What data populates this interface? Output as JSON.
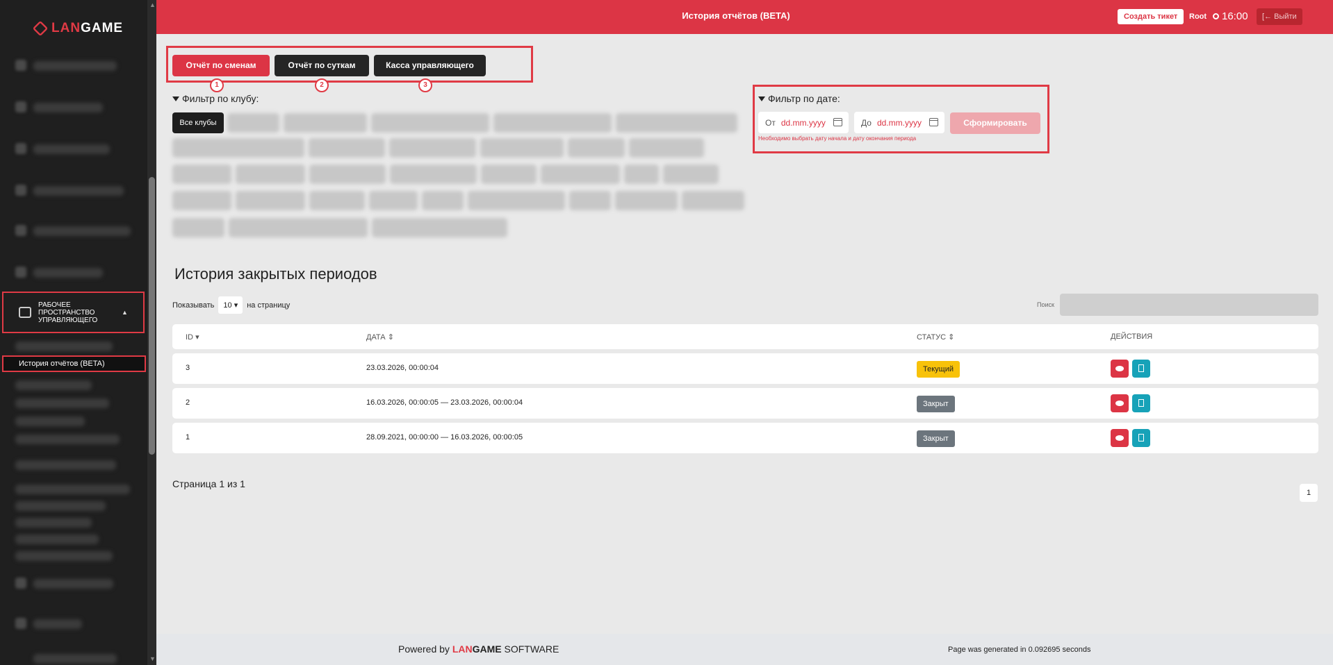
{
  "brand": {
    "logo_prefix": "LAN",
    "logo_suffix": "GAME"
  },
  "header": {
    "title": "История отчётов (BETA)",
    "create_ticket": "Создать тикет",
    "user": "Root",
    "time": "16:00",
    "logout": "Выйти"
  },
  "sidebar": {
    "section_label": "Рабочее пространство управляющего",
    "active_item": "История отчётов (BETA)"
  },
  "tabs": [
    {
      "label": "Отчёт по сменам",
      "badge": "1"
    },
    {
      "label": "Отчёт по суткам",
      "badge": "2"
    },
    {
      "label": "Касса управляющего",
      "badge": "3"
    }
  ],
  "club_filter": {
    "title": "Фильтр по клубу:",
    "all_clubs": "Все клубы"
  },
  "date_filter": {
    "title": "Фильтр по дате:",
    "from_label": "От",
    "from_placeholder": "dd.mm.yyyy",
    "to_label": "До",
    "to_placeholder": "dd.mm.yyyy",
    "generate": "Сформировать",
    "warning": "Необходимо выбрать дату начала и дату окончания периода"
  },
  "history": {
    "title": "История закрытых периодов",
    "show_prefix": "Показывать",
    "page_size": "10",
    "show_suffix": "на страницу",
    "search_label": "Поиск",
    "columns": {
      "id": "ID",
      "date": "ДАТА",
      "status": "СТАТУС",
      "actions": "ДЕЙСТВИЯ"
    },
    "rows": [
      {
        "id": "3",
        "date": "23.03.2026, 00:00:04",
        "status": "Текущий"
      },
      {
        "id": "2",
        "date": "16.03.2026, 00:00:05 — 23.03.2026, 00:00:04",
        "status": "Закрыт"
      },
      {
        "id": "1",
        "date": "28.09.2021, 00:00:00 — 16.03.2026, 00:00:05",
        "status": "Закрыт"
      }
    ],
    "page_info": "Страница 1 из 1",
    "current_page": "1"
  },
  "footer": {
    "powered_by": "Powered by",
    "brand_prefix": "LAN",
    "brand_suffix": "GAME",
    "software": "SOFTWARE",
    "generated": "Page was generated in 0.092695 seconds"
  },
  "colors": {
    "accent": "#dc3545",
    "dark": "#252525",
    "current": "#f8c20a",
    "closed": "#6c757d",
    "info": "#17a2b8"
  }
}
